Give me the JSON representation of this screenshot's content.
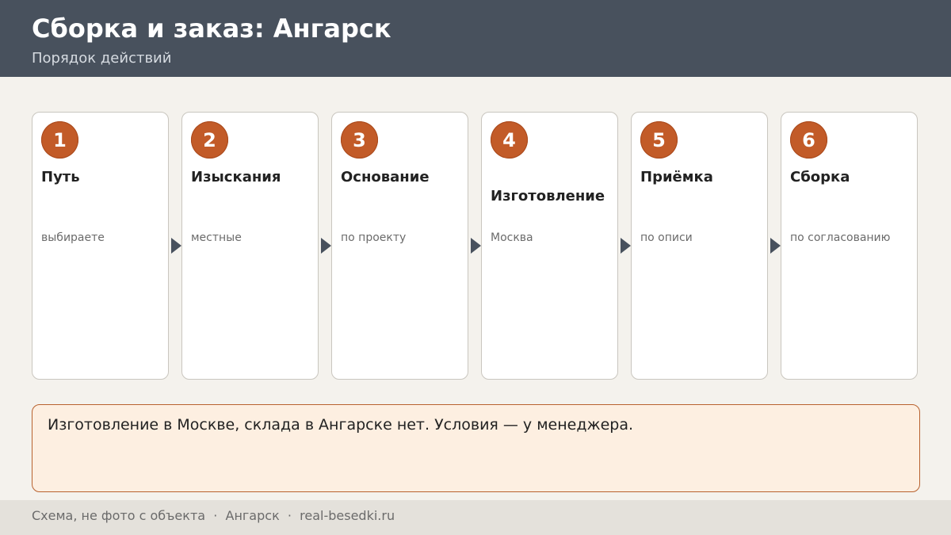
{
  "header": {
    "title": "Сборка и заказ: Ангарск",
    "subtitle": "Порядок действий"
  },
  "steps": [
    {
      "number": "1",
      "title": "Путь",
      "description": "выбираете"
    },
    {
      "number": "2",
      "title": "Изыскания",
      "description": "местные"
    },
    {
      "number": "3",
      "title": "Основание",
      "description": "по проекту"
    },
    {
      "number": "4",
      "title": "Изготовление",
      "description": "Москва"
    },
    {
      "number": "5",
      "title": "Приёмка",
      "description": "по описи"
    },
    {
      "number": "6",
      "title": "Сборка",
      "description": "по согласованию"
    }
  ],
  "note": {
    "text": "Изготовление в Москве, склада в Ангарске нет. Условия — у менеджера."
  },
  "footer": {
    "text": "Схема, не фото с объекта  ·  Ангарск  ·  real-besedki.ru"
  },
  "colors": {
    "header_bg": "#48515d",
    "accent": "#c25b28",
    "note_bg": "#fdefe1",
    "page_bg": "#f4f2ed"
  }
}
